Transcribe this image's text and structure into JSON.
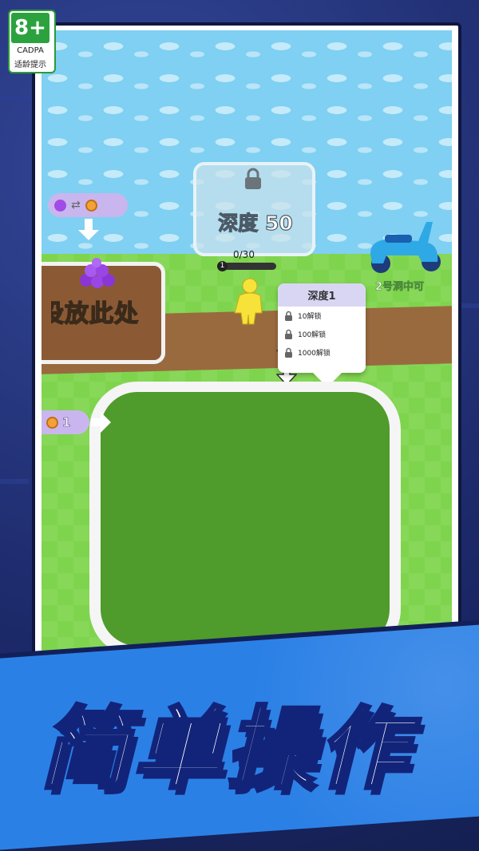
{
  "age_rating": {
    "value": "8+",
    "org": "CADPA",
    "note": "适龄提示"
  },
  "game": {
    "depth_sign": "深度 50",
    "counter": "0/30",
    "player_level": "1",
    "capacity_progress": 0,
    "drop_zone_label": "投放此处",
    "unlock_hint": "2号洞中可",
    "coin_reward": "1",
    "popup": {
      "title": "深度1",
      "rows": [
        {
          "cost": "10解锁"
        },
        {
          "cost": "100解锁"
        },
        {
          "cost": "1000解锁"
        }
      ]
    },
    "icons": {
      "lock": "lock-icon",
      "coin": "coin-icon",
      "swap": "swap-icon",
      "arrow": "down-arrow-icon"
    }
  },
  "banner": {
    "tagline": "简单操作"
  },
  "colors": {
    "water": "#7fd0f2",
    "grass": "#7fd44e",
    "hole": "#4f9b2c",
    "banner": "#2b80e6",
    "badge_green": "#2ca23f"
  }
}
